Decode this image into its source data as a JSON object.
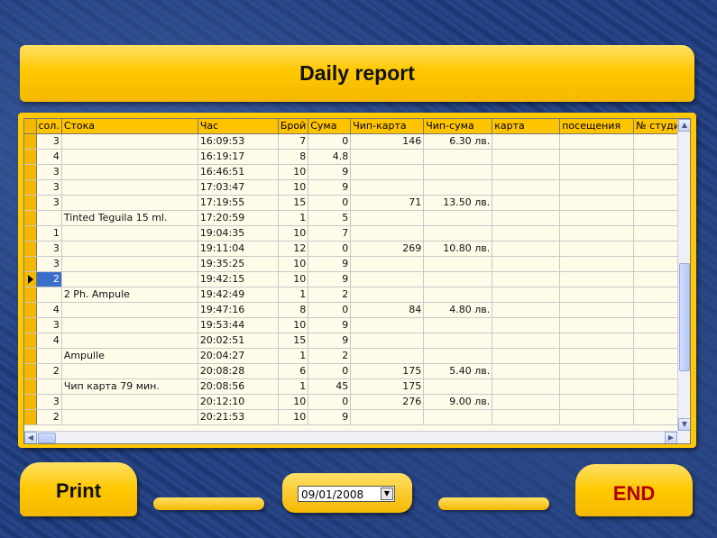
{
  "header": {
    "title": "Daily report"
  },
  "grid": {
    "columns": [
      "сол.",
      "Стока",
      "Час",
      "Брой",
      "Сума",
      "Чип-карта",
      "Чип-сума",
      "карта",
      "посещения",
      "№ студи"
    ],
    "rows": [
      [
        "3",
        "",
        "16:09:53",
        "7",
        "0",
        "146",
        "6.30 лв.",
        "",
        "",
        ""
      ],
      [
        "4",
        "",
        "16:19:17",
        "8",
        "4.8",
        "",
        "",
        "",
        "",
        ""
      ],
      [
        "3",
        "",
        "16:46:51",
        "10",
        "9",
        "",
        "",
        "",
        "",
        ""
      ],
      [
        "3",
        "",
        "17:03:47",
        "10",
        "9",
        "",
        "",
        "",
        "",
        ""
      ],
      [
        "3",
        "",
        "17:19:55",
        "15",
        "0",
        "71",
        "13.50 лв.",
        "",
        "",
        ""
      ],
      [
        "",
        "Tinted Teguila 15 ml.",
        "17:20:59",
        "1",
        "5",
        "",
        "",
        "",
        "",
        ""
      ],
      [
        "1",
        "",
        "19:04:35",
        "10",
        "7",
        "",
        "",
        "",
        "",
        ""
      ],
      [
        "3",
        "",
        "19:11:04",
        "12",
        "0",
        "269",
        "10.80 лв.",
        "",
        "",
        ""
      ],
      [
        "3",
        "",
        "19:35:25",
        "10",
        "9",
        "",
        "",
        "",
        "",
        ""
      ],
      [
        "2",
        "",
        "19:42:15",
        "10",
        "9",
        "",
        "",
        "",
        "",
        ""
      ],
      [
        "",
        "2 Ph. Ampule",
        "19:42:49",
        "1",
        "2",
        "",
        "",
        "",
        "",
        ""
      ],
      [
        "4",
        "",
        "19:47:16",
        "8",
        "0",
        "84",
        "4.80 лв.",
        "",
        "",
        ""
      ],
      [
        "3",
        "",
        "19:53:44",
        "10",
        "9",
        "",
        "",
        "",
        "",
        ""
      ],
      [
        "4",
        "",
        "20:02:51",
        "15",
        "9",
        "",
        "",
        "",
        "",
        ""
      ],
      [
        "",
        "Ampulle",
        "20:04:27",
        "1",
        "2",
        "",
        "",
        "",
        "",
        ""
      ],
      [
        "2",
        "",
        "20:08:28",
        "6",
        "0",
        "175",
        "5.40 лв.",
        "",
        "",
        ""
      ],
      [
        "",
        "Чип карта  79 мин.",
        "20:08:56",
        "1",
        "45",
        "175",
        "",
        "",
        "",
        ""
      ],
      [
        "3",
        "",
        "20:12:10",
        "10",
        "0",
        "276",
        "9.00 лв.",
        "",
        "",
        ""
      ],
      [
        "2",
        "",
        "20:21:53",
        "10",
        "9",
        "",
        "",
        "",
        "",
        ""
      ]
    ],
    "selected_row": 9
  },
  "footer": {
    "print_label": "Print",
    "end_label": "END",
    "date_value": "09/01/2008"
  },
  "icons": {
    "scroll_up": "scroll-up-arrow-icon",
    "scroll_down": "scroll-down-arrow-icon",
    "scroll_left": "scroll-left-arrow-icon",
    "scroll_right": "scroll-right-arrow-icon",
    "row_pointer": "row-pointer-icon",
    "dropdown": "dropdown-arrow-icon"
  },
  "colors": {
    "accent": "#ffc800",
    "background": "#203c7a",
    "end_text": "#b00000",
    "selected": "#3a6ec8"
  }
}
